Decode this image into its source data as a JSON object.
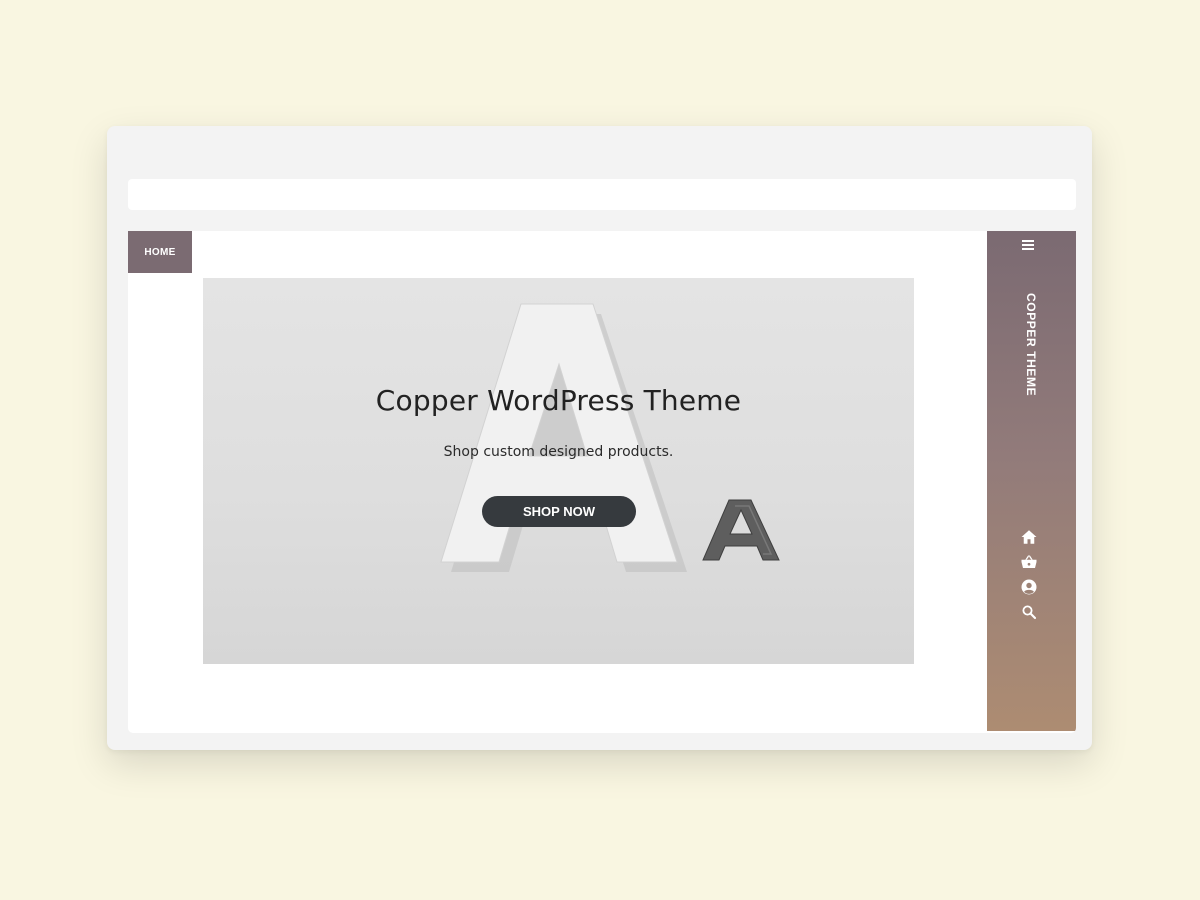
{
  "nav": {
    "home_label": "HOME"
  },
  "hero": {
    "title": "Copper WordPress Theme",
    "subtitle": "Shop custom designed products.",
    "cta_label": "SHOP NOW"
  },
  "sidebar": {
    "site_name": "COPPER THEME",
    "icons": [
      "menu-icon",
      "home-icon",
      "basket-icon",
      "account-icon",
      "search-icon"
    ]
  },
  "colors": {
    "background": "#f9f6e1",
    "accent": "#7b6b72",
    "sidebar_gradient_top": "#7b6a72",
    "sidebar_gradient_bottom": "#ad8c72",
    "button": "#363a3e"
  }
}
